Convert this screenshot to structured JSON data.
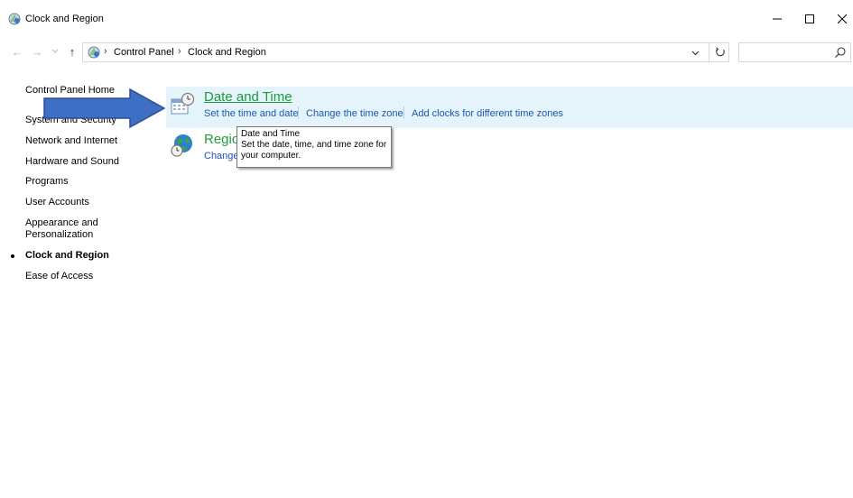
{
  "window": {
    "title": "Clock and Region",
    "controls": [
      "minimize",
      "maximize",
      "close"
    ]
  },
  "addressbar": {
    "crumbs": [
      "Control Panel",
      "Clock and Region"
    ],
    "search_placeholder": ""
  },
  "sidebar": {
    "home": "Control Panel Home",
    "items": [
      {
        "label": "System and Security",
        "active": false
      },
      {
        "label": "Network and Internet",
        "active": false
      },
      {
        "label": "Hardware and Sound",
        "active": false
      },
      {
        "label": "Programs",
        "active": false
      },
      {
        "label": "User Accounts",
        "active": false
      },
      {
        "label": "Appearance and",
        "label2": "Personalization",
        "active": false
      },
      {
        "label": "Clock and Region",
        "active": true
      },
      {
        "label": "Ease of Access",
        "active": false
      }
    ]
  },
  "categories": [
    {
      "title": "Date and Time",
      "icon": "clock-calendar-icon",
      "tasks": [
        "Set the time and date",
        "Change the time zone",
        "Add clocks for different time zones"
      ]
    },
    {
      "title": "Region",
      "icon": "globe-clock-icon",
      "tasks": [
        "Change"
      ]
    }
  ],
  "tooltip": {
    "title": "Date and Time",
    "line1": "Set the date, time, and time zone for",
    "line2": "your computer."
  },
  "colors": {
    "highlight": "#e5f3fb",
    "category_title": "#1e9c3a",
    "task_link": "#1a56b5",
    "annotation_arrow": "#3f6fc4"
  }
}
